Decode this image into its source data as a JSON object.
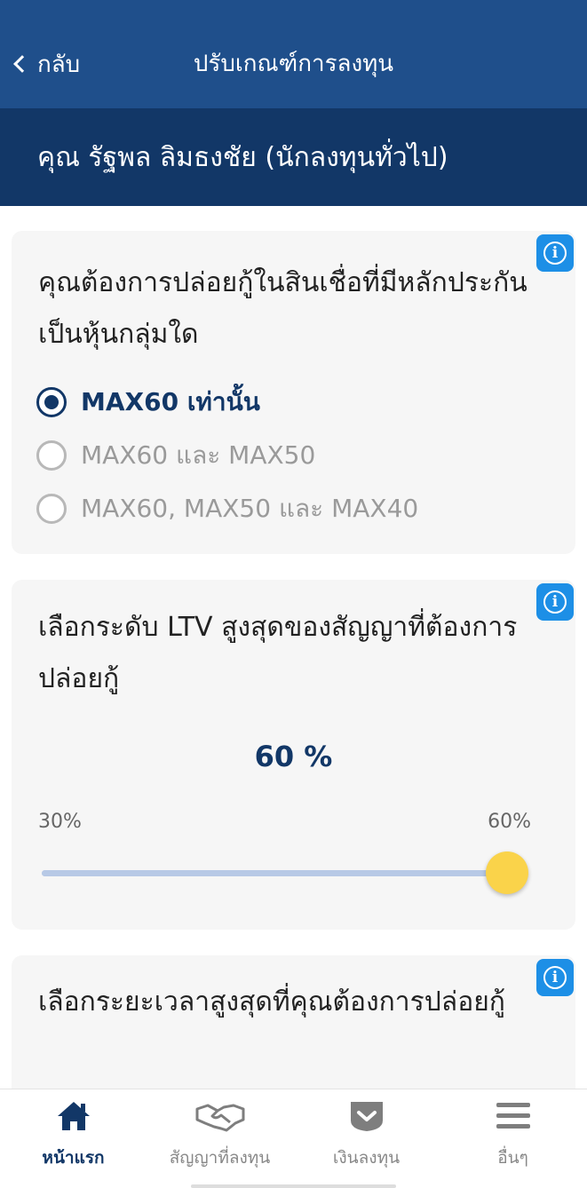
{
  "header": {
    "back_label": "กลับ",
    "title": "ปรับเกณฑ์การลงทุน"
  },
  "user": {
    "name": "คุณ รัฐพล ลิมธงชัย (นักลงทุนทั่วไป)"
  },
  "collateral": {
    "question": "คุณต้องการปล่อยกู้ในสินเชื่อที่มีหลักประกันเป็นหุ้นกลุ่มใด",
    "options": [
      {
        "label": "MAX60 เท่านั้น",
        "selected": true
      },
      {
        "label": "MAX60 และ MAX50",
        "selected": false
      },
      {
        "label": "MAX60, MAX50 และ MAX40",
        "selected": false
      }
    ]
  },
  "ltv": {
    "question": "เลือกระดับ LTV สูงสุดของสัญญาที่ต้องการปล่อยกู้",
    "value_label": "60 %",
    "min_label": "30%",
    "max_label": "60%",
    "level": 1.0
  },
  "duration": {
    "question": "เลือกระยะเวลาสูงสุดที่คุณต้องการปล่อยกู้"
  },
  "tabbar": {
    "items": [
      {
        "label": "หน้าแรก",
        "icon": "home-icon",
        "active": true
      },
      {
        "label": "สัญญาที่ลงทุน",
        "icon": "handshake-icon",
        "active": false
      },
      {
        "label": "เงินลงทุน",
        "icon": "wallet-icon",
        "active": false
      },
      {
        "label": "อื่นๆ",
        "icon": "menu-icon",
        "active": false
      }
    ]
  },
  "colors": {
    "header": "#1f4f8b",
    "user_bar": "#123767",
    "accent": "#123767",
    "info_button": "#1d8fe6",
    "slider_thumb": "#fad34a"
  }
}
